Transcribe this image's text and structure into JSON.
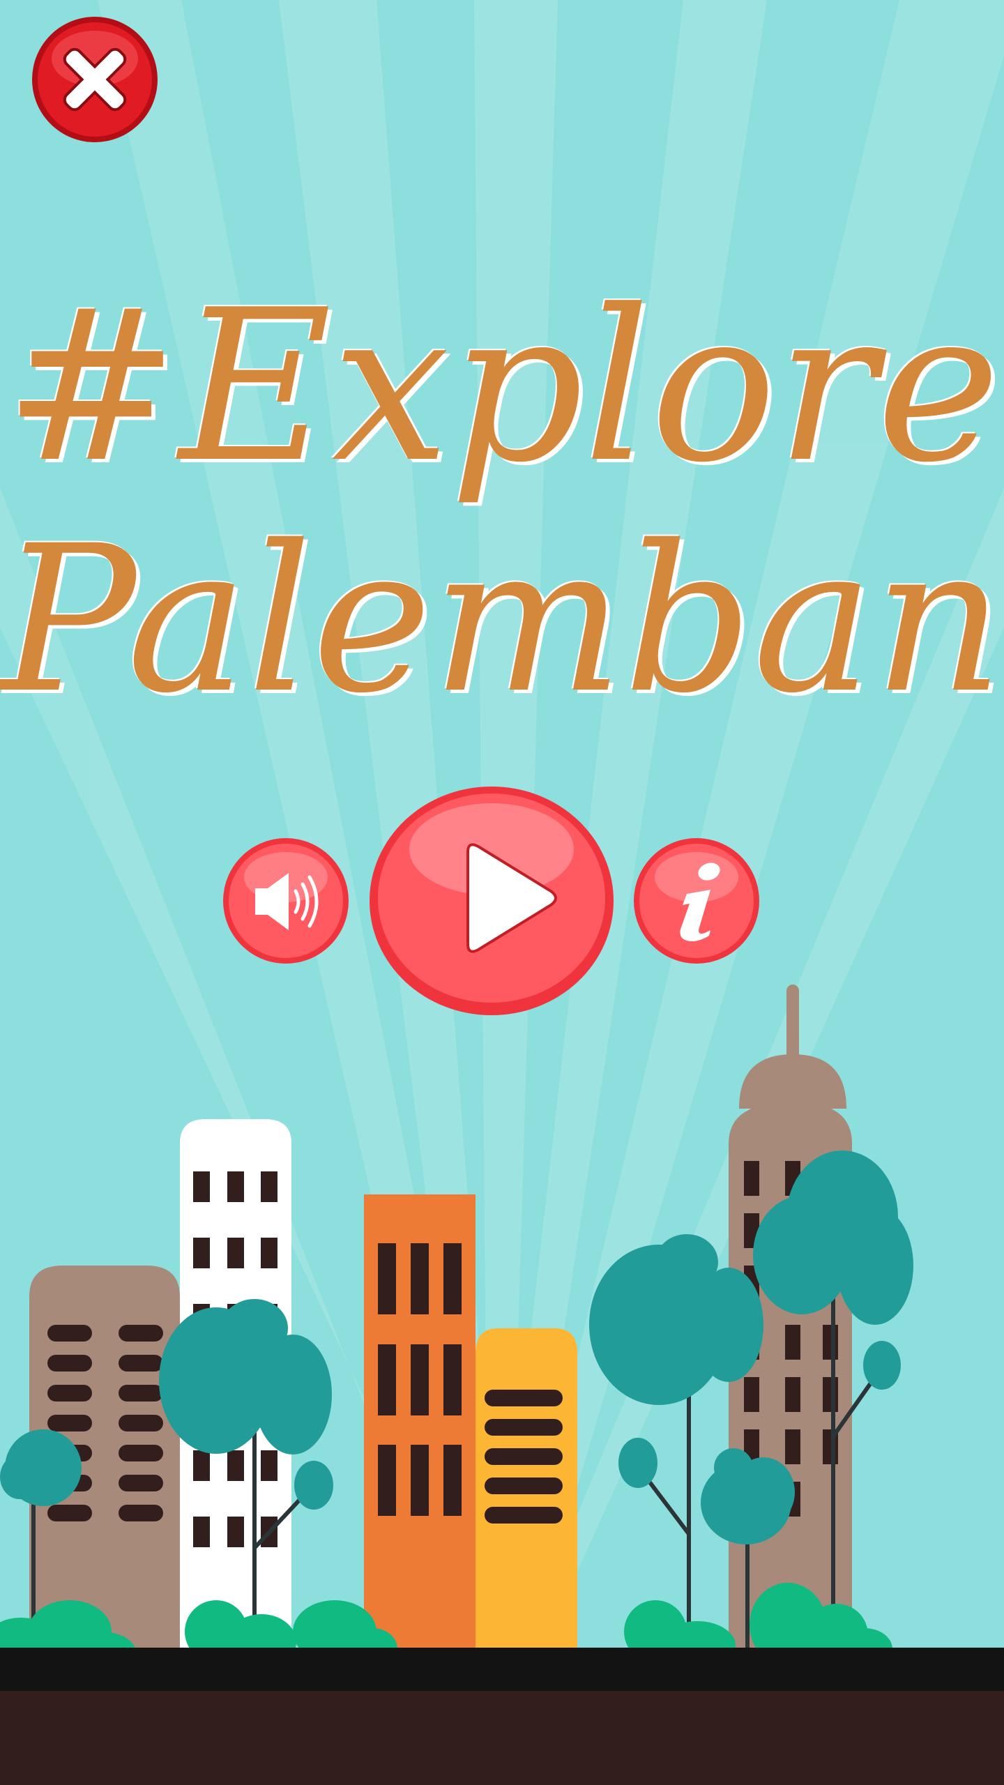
{
  "title": {
    "line1": "#Explore",
    "line2": "Palembang"
  },
  "buttons": {
    "close": {
      "icon": "close-icon"
    },
    "sound": {
      "icon": "speaker-icon"
    },
    "play": {
      "icon": "play-icon"
    },
    "info": {
      "icon": "info-icon"
    }
  },
  "colors": {
    "sky": "#8ddfdd",
    "title": "#d3883b",
    "button_red": "#ff5a62",
    "close_red": "#d9121c",
    "ground": "#331e1e",
    "road": "#131313"
  }
}
